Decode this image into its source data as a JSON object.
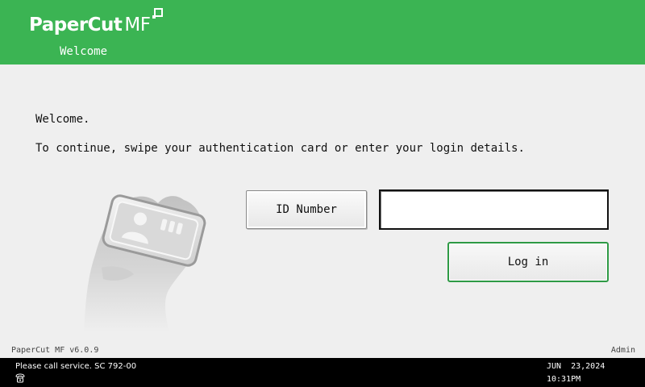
{
  "header": {
    "brand": "PaperCut",
    "brand_suffix": "MF",
    "subtitle": "Welcome"
  },
  "main": {
    "welcome": "Welcome.",
    "instruction": "To continue, swipe your authentication card or enter your login details.",
    "id_button_label": "ID Number",
    "id_input_value": "",
    "login_button_label": "Log in",
    "illustration_icon": "hand-holding-card-icon"
  },
  "footer": {
    "version": "PaperCut MF v6.0.9",
    "admin_label": "Admin"
  },
  "status_bar": {
    "message": "Please call service. SC 792-00",
    "icon": "phone-icon",
    "date": "JUN  23,2024",
    "time": "10:31PM"
  },
  "colors": {
    "brand_green": "#3bb453",
    "status_bar": "#000000",
    "background": "#efefef"
  }
}
